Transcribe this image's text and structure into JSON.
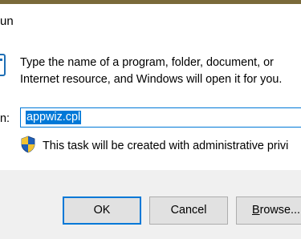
{
  "window": {
    "title_partial": "un"
  },
  "dialog": {
    "message": "Type the name of a program, folder, document, or Internet resource, and Windows will open it for you.",
    "open_label_partial": "n:",
    "open_value": "appwiz.cpl",
    "admin_note": "This task will be created with administrative privi"
  },
  "buttons": {
    "ok": "OK",
    "cancel": "Cancel",
    "browse_first": "B",
    "browse_rest": "rowse..."
  },
  "colors": {
    "accent": "#0078d7",
    "footer_bg": "#f0f0f0",
    "button_bg": "#e1e1e1"
  },
  "icons": {
    "app": "run-icon",
    "uac": "uac-shield-icon"
  }
}
